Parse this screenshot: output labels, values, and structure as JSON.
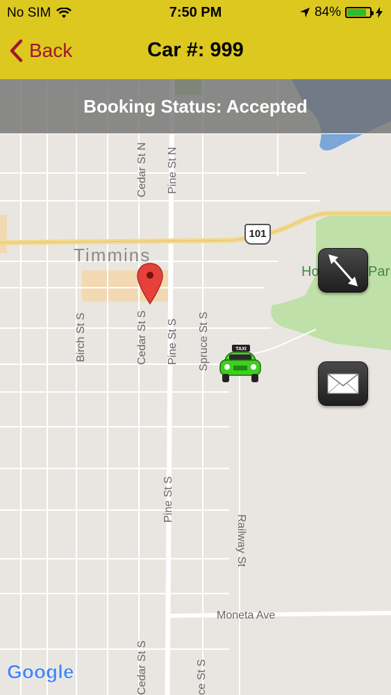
{
  "status_bar": {
    "carrier": "No SIM",
    "time": "7:50 PM",
    "battery": "84%",
    "battery_level": 84
  },
  "nav": {
    "back_label": "Back",
    "title": "Car #: 999"
  },
  "booking": {
    "status_text": "Booking Status: Accepted"
  },
  "map": {
    "city_label": "Timmins",
    "highway_label": "101",
    "park_label_left": "Ho",
    "park_label_right": "Par",
    "streets": {
      "cedar_n": "Cedar St N",
      "pine_n": "Pine St N",
      "birch_s": "Birch St S",
      "cedar_s": "Cedar St S",
      "pine_s": "Pine St S",
      "spruce_s": "Spruce St S",
      "pine_s_lower": "Pine St S",
      "railway": "Railway St",
      "moneta": "Moneta Ave",
      "cedar_s_bottom": "Cedar St S",
      "spruce_s_bottom": "ce St S"
    },
    "attribution": "Google",
    "taxi_sign": "TAXI"
  },
  "colors": {
    "bar": "#dcc81f",
    "back": "#a0182c",
    "map_bg": "#e9e6e1",
    "park": "#bfe0a8",
    "water": "#7aa6d8",
    "highway": "#f2d98e"
  },
  "icons": {
    "expand": "diagonal-arrows-icon",
    "message": "envelope-icon",
    "pin": "map-pin-icon",
    "taxi": "taxi-icon"
  }
}
